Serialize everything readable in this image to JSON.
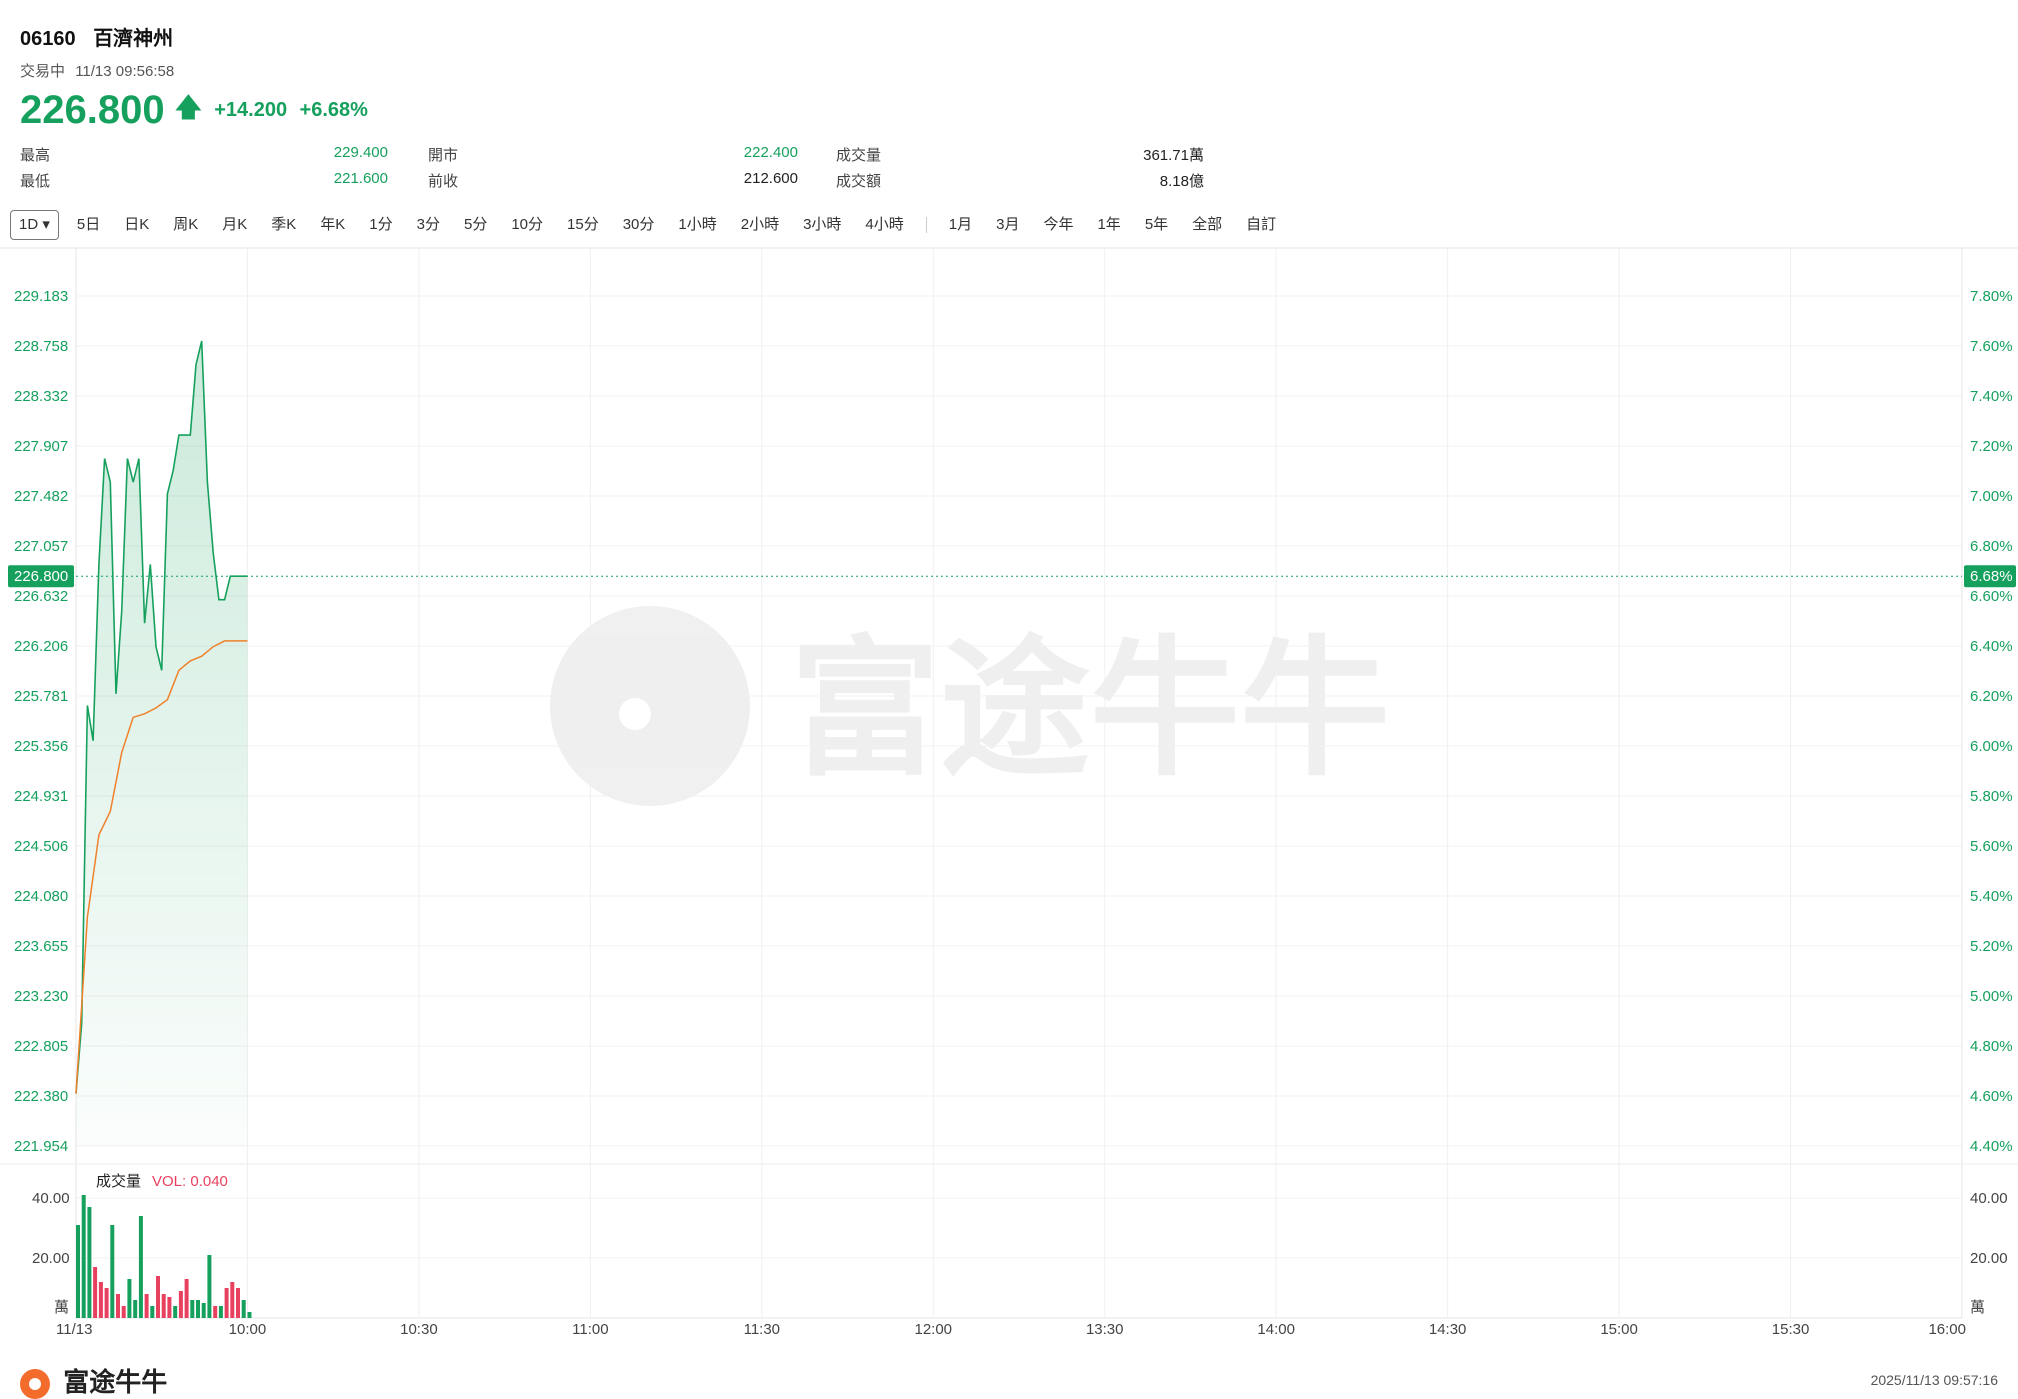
{
  "header": {
    "code": "06160",
    "name": "百濟神州",
    "status": "交易中",
    "datetime": "11/13 09:56:58",
    "price": "226.800",
    "change": "+14.200",
    "change_pct": "+6.68%"
  },
  "stats": {
    "high_label": "最高",
    "high": "229.400",
    "low_label": "最低",
    "low": "221.600",
    "open_label": "開市",
    "open": "222.400",
    "prev_label": "前收",
    "prev": "212.600",
    "vol_label": "成交量",
    "vol": "361.71萬",
    "amt_label": "成交額",
    "amt": "8.18億"
  },
  "tabs": [
    "1D",
    "5日",
    "日K",
    "周K",
    "月K",
    "季K",
    "年K",
    "1分",
    "3分",
    "5分",
    "10分",
    "15分",
    "30分",
    "1小時",
    "2小時",
    "3小時",
    "4小時",
    "1月",
    "3月",
    "今年",
    "1年",
    "5年",
    "全部",
    "自訂"
  ],
  "tab_active": "1D",
  "footer": {
    "brand": "富途牛牛",
    "timestamp": "2025/11/13 09:57:16"
  },
  "colors": {
    "up": "#16a05d",
    "down": "#e8415f",
    "avg": "#f0812a",
    "fill": "#16a05d"
  },
  "chart_data": {
    "type": "line",
    "price_axis": {
      "ticks": [
        "229.183",
        "228.758",
        "228.332",
        "227.907",
        "227.482",
        "227.057",
        "226.632",
        "226.206",
        "225.781",
        "225.356",
        "224.931",
        "224.506",
        "224.080",
        "223.655",
        "223.230",
        "222.805",
        "222.380",
        "221.954"
      ],
      "min": 221.954,
      "max": 229.183
    },
    "pct_axis": {
      "ticks": [
        "7.80%",
        "7.60%",
        "7.40%",
        "7.20%",
        "7.00%",
        "6.80%",
        "6.60%",
        "6.40%",
        "6.20%",
        "6.00%",
        "5.80%",
        "5.60%",
        "5.40%",
        "5.20%",
        "5.00%",
        "4.80%",
        "4.60%",
        "4.40%"
      ]
    },
    "current_price_label": "226.800",
    "current_pct_label": "6.68%",
    "current_price": 226.8,
    "x_ticks": [
      "11/13",
      "10:00",
      "10:30",
      "11:00",
      "11:30",
      "12:00",
      "13:30",
      "14:00",
      "14:30",
      "15:00",
      "15:30",
      "16:00"
    ],
    "x_minutes": [
      0,
      30,
      60,
      90,
      120,
      150,
      180,
      210,
      240,
      270,
      300,
      330
    ],
    "price_series": {
      "minutes": [
        0,
        1,
        2,
        3,
        4,
        5,
        6,
        7,
        8,
        9,
        10,
        11,
        12,
        13,
        14,
        15,
        16,
        17,
        18,
        19,
        20,
        21,
        22,
        23,
        24,
        25,
        26,
        27,
        28,
        29,
        30
      ],
      "values": [
        222.4,
        223.0,
        225.7,
        225.4,
        226.9,
        227.8,
        227.6,
        225.8,
        226.5,
        227.8,
        227.6,
        227.8,
        226.4,
        226.9,
        226.2,
        226.0,
        227.5,
        227.7,
        228.0,
        228.0,
        228.0,
        228.6,
        228.8,
        227.6,
        227.0,
        226.6,
        226.6,
        226.8,
        226.8,
        226.8,
        226.8
      ]
    },
    "avg_series": {
      "minutes": [
        0,
        2,
        4,
        6,
        8,
        10,
        12,
        14,
        16,
        18,
        20,
        22,
        24,
        26,
        28,
        30
      ],
      "values": [
        222.4,
        223.9,
        224.6,
        224.8,
        225.3,
        225.6,
        225.63,
        225.68,
        225.75,
        226.0,
        226.08,
        226.12,
        226.2,
        226.25,
        226.25,
        226.25
      ]
    },
    "volume": {
      "label": "成交量",
      "vol_readout": "VOL: 0.040",
      "ticks": [
        "40.00",
        "20.00"
      ],
      "unit": "萬",
      "max": 44,
      "values": [
        31,
        41,
        37,
        17,
        12,
        10,
        31,
        8,
        4,
        13,
        6,
        34,
        8,
        4,
        14,
        8,
        7,
        4,
        9,
        13,
        6,
        6,
        5,
        21,
        4,
        4,
        10,
        12,
        10,
        6,
        2
      ],
      "direction": [
        "up",
        "up",
        "up",
        "down",
        "down",
        "down",
        "up",
        "down",
        "down",
        "up",
        "up",
        "up",
        "down",
        "up",
        "down",
        "down",
        "down",
        "up",
        "down",
        "down",
        "up",
        "up",
        "up",
        "up",
        "down",
        "up",
        "down",
        "down",
        "down",
        "up",
        "up"
      ]
    }
  }
}
